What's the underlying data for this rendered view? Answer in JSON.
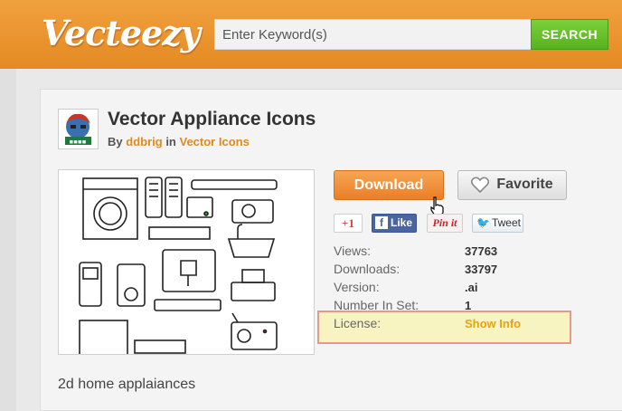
{
  "header": {
    "logo": "Vecteezy",
    "search_placeholder": "Enter Keyword(s)",
    "search_button": "SEARCH",
    "brand_color": "#e8912d"
  },
  "item": {
    "title": "Vector Appliance Icons",
    "by_label": "By",
    "author": "ddbrig",
    "in_label": "in",
    "category": "Vector Icons",
    "description": "2d home applaiances"
  },
  "actions": {
    "download": "Download",
    "favorite": "Favorite"
  },
  "social": {
    "gplus": "+1",
    "like": "Like",
    "pinit": "Pin it",
    "tweet": "Tweet"
  },
  "stats": [
    {
      "label": "Views:",
      "value": "37763"
    },
    {
      "label": "Downloads:",
      "value": "33797"
    },
    {
      "label": "Version:",
      "value": ".ai"
    },
    {
      "label": "Number In Set:",
      "value": "1"
    },
    {
      "label": "License:",
      "value": "Show Info"
    }
  ]
}
